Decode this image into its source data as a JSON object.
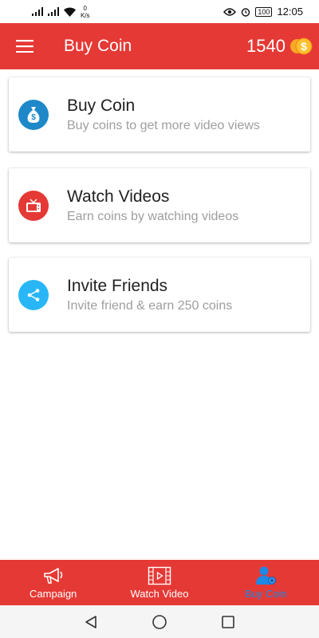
{
  "status_bar": {
    "speed_value": "0",
    "speed_unit": "K/s",
    "battery": "100",
    "time": "12:05"
  },
  "app_bar": {
    "title": "Buy Coin",
    "coin_balance": "1540",
    "accent": "#e53935"
  },
  "cards": [
    {
      "title": "Buy Coin",
      "subtitle": "Buy coins to get more video views",
      "icon": "money-bag-icon",
      "icon_color": "#1e88c9"
    },
    {
      "title": "Watch Videos",
      "subtitle": "Earn coins by watching videos",
      "icon": "tv-icon",
      "icon_color": "#e53935"
    },
    {
      "title": "Invite Friends",
      "subtitle": "Invite friend & earn 250 coins",
      "icon": "share-icon",
      "icon_color": "#29b6f6"
    }
  ],
  "bottom_nav": {
    "items": [
      {
        "label": "Campaign",
        "icon": "megaphone-icon"
      },
      {
        "label": "Watch Video",
        "icon": "video-film-icon"
      },
      {
        "label": "Buy Coin",
        "icon": "coin-user-icon",
        "active": true
      }
    ],
    "active_color": "#1e88e5"
  }
}
